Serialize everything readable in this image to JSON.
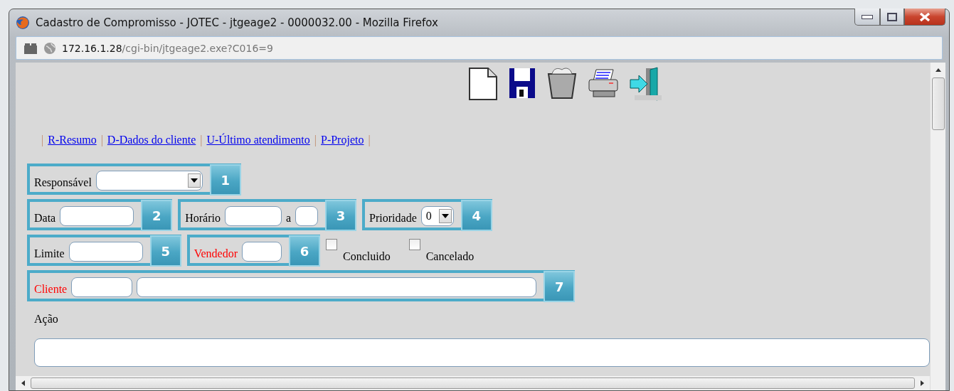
{
  "window": {
    "title": "Cadastro de Compromisso - JOTEC - jtgeage2 - 0000032.00 - Mozilla Firefox"
  },
  "address_bar": {
    "host": "172.16.1.28",
    "path": "/cgi-bin/jtgeage2.exe?C016=9"
  },
  "nav": [
    {
      "kind": "separator",
      "text": "|"
    },
    {
      "kind": "link",
      "text": "R-Resumo"
    },
    {
      "kind": "separator",
      "text": "|"
    },
    {
      "kind": "link",
      "text": "D-Dados do cliente"
    },
    {
      "kind": "separator",
      "text": "|"
    },
    {
      "kind": "link",
      "text": "U-Último atendimento"
    },
    {
      "kind": "separator",
      "text": "|"
    },
    {
      "kind": "link",
      "text": "P-Projeto"
    },
    {
      "kind": "separator",
      "text": "|"
    }
  ],
  "form_rows": [
    [
      {
        "kind": "callout",
        "number": "1",
        "fields": [
          {
            "kind": "select",
            "label": "Responsável",
            "required": false
          }
        ]
      }
    ],
    [
      {
        "kind": "callout",
        "number": "2",
        "fields": [
          {
            "kind": "input",
            "label": "Data",
            "required": false
          }
        ]
      },
      {
        "kind": "callout",
        "number": "3",
        "fields": [
          {
            "kind": "input",
            "label": "Horário",
            "required": false
          },
          {
            "kind": "input",
            "label": "a",
            "required": false
          }
        ]
      },
      {
        "kind": "callout",
        "number": "4",
        "fields": [
          {
            "kind": "select",
            "label": "Prioridade",
            "value": "0",
            "required": false
          }
        ]
      }
    ],
    [
      {
        "kind": "callout",
        "number": "5",
        "fields": [
          {
            "kind": "input",
            "label": "Limite",
            "required": false
          }
        ]
      },
      {
        "kind": "callout",
        "number": "6",
        "fields": [
          {
            "kind": "input",
            "label": "Vendedor",
            "required": true
          }
        ]
      },
      {
        "kind": "checkbox",
        "label": "Concluido",
        "checked": false
      },
      {
        "kind": "checkbox",
        "label": "Cancelado",
        "checked": false
      }
    ],
    [
      {
        "kind": "callout",
        "number": "7",
        "fields": [
          {
            "kind": "input",
            "label": "Cliente",
            "required": true
          },
          {
            "kind": "input"
          }
        ]
      }
    ]
  ],
  "action": {
    "label": "Ação"
  }
}
